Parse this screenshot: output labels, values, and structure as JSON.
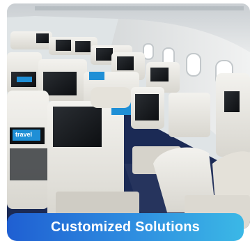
{
  "image": {
    "subject": "cabin-seats",
    "brand_screen_text": "travel"
  },
  "banner": {
    "title": "Customized Solutions"
  },
  "colors": {
    "carpet": "#1b2a55",
    "seat_shell": "#e9e7e1",
    "screen_blue": "#1f8fd6",
    "banner_start": "#1f5fd2",
    "banner_end": "#3bb8e6"
  }
}
